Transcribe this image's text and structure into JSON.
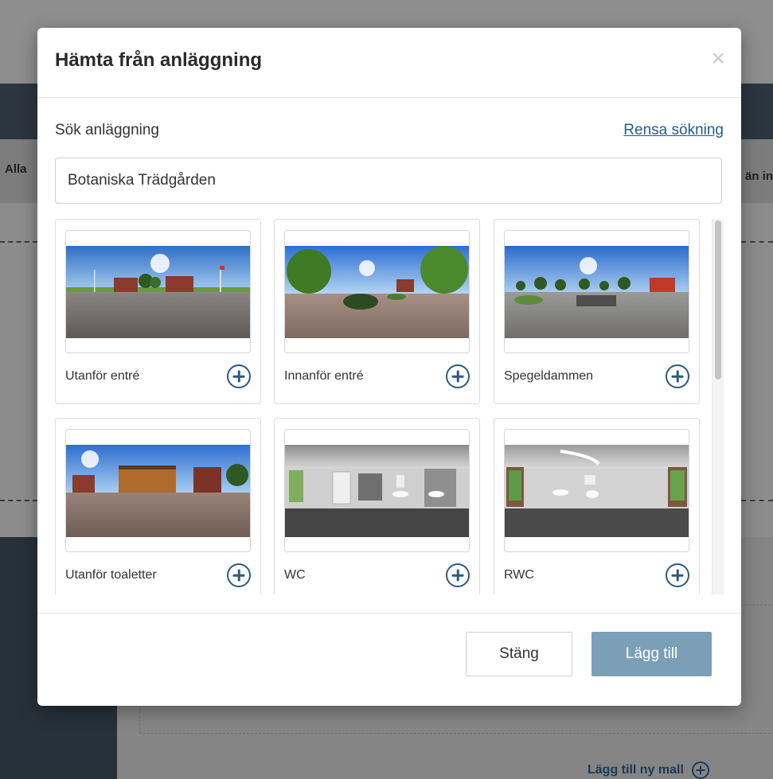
{
  "background": {
    "filter_left": "Alla",
    "filter_right": "än in",
    "add_template_label": "Lägg till ny mall"
  },
  "modal": {
    "title": "Hämta från anläggning",
    "close_icon": "close-icon",
    "search_label": "Sök anläggning",
    "clear_search_label": "Rensa sökning",
    "search_value": "Botaniska Trädgården",
    "items": [
      {
        "label": "Utanför entré"
      },
      {
        "label": "Innanför entré"
      },
      {
        "label": "Spegeldammen"
      },
      {
        "label": "Utanför toaletter"
      },
      {
        "label": "WC"
      },
      {
        "label": "RWC"
      }
    ],
    "footer": {
      "close_label": "Stäng",
      "add_label": "Lägg till"
    }
  },
  "colors": {
    "accent": "#2a5a84",
    "primary_button": "#7c9fb8",
    "link": "#1d5f8a"
  }
}
